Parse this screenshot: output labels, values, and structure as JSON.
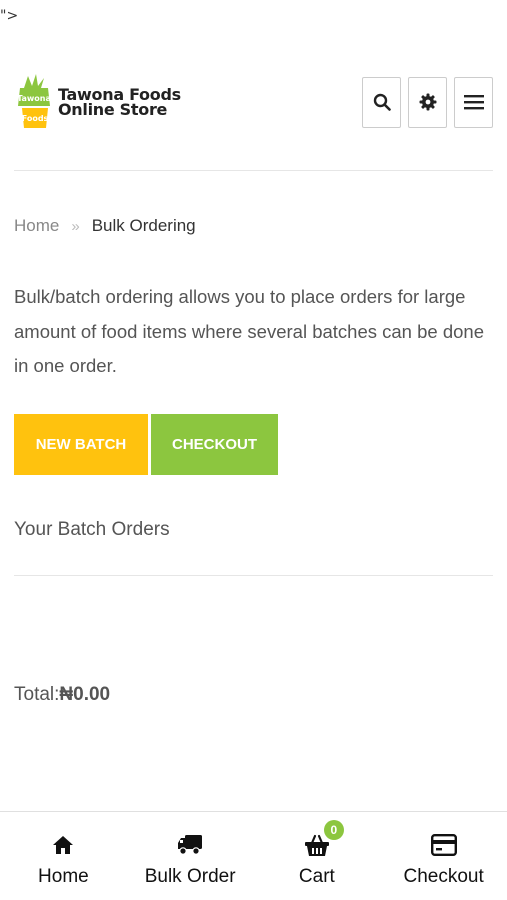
{
  "stray_text": "\">",
  "logo": {
    "badge_top": "Tawona",
    "badge_bottom": "Foods",
    "line1": "Tawona Foods",
    "line2": "Online Store"
  },
  "header_icons": [
    "search-icon",
    "gear-icon",
    "menu-icon"
  ],
  "breadcrumb": {
    "home": "Home",
    "separator": "»",
    "current": "Bulk Ordering"
  },
  "intro_text": "Bulk/batch ordering allows you to place orders for large amount of food items where several batches can be done in one order.",
  "actions": {
    "new_batch": "NEW BATCH",
    "checkout": "CHECKOUT"
  },
  "section_title": "Your Batch Orders",
  "total": {
    "label": "Total: ",
    "value": "₦0.00"
  },
  "bottom_nav": {
    "home": "Home",
    "bulk_order": "Bulk Order",
    "cart": "Cart",
    "cart_count": "0",
    "checkout": "Checkout"
  },
  "colors": {
    "yellow": "#ffc20e",
    "green": "#8cc63f"
  }
}
